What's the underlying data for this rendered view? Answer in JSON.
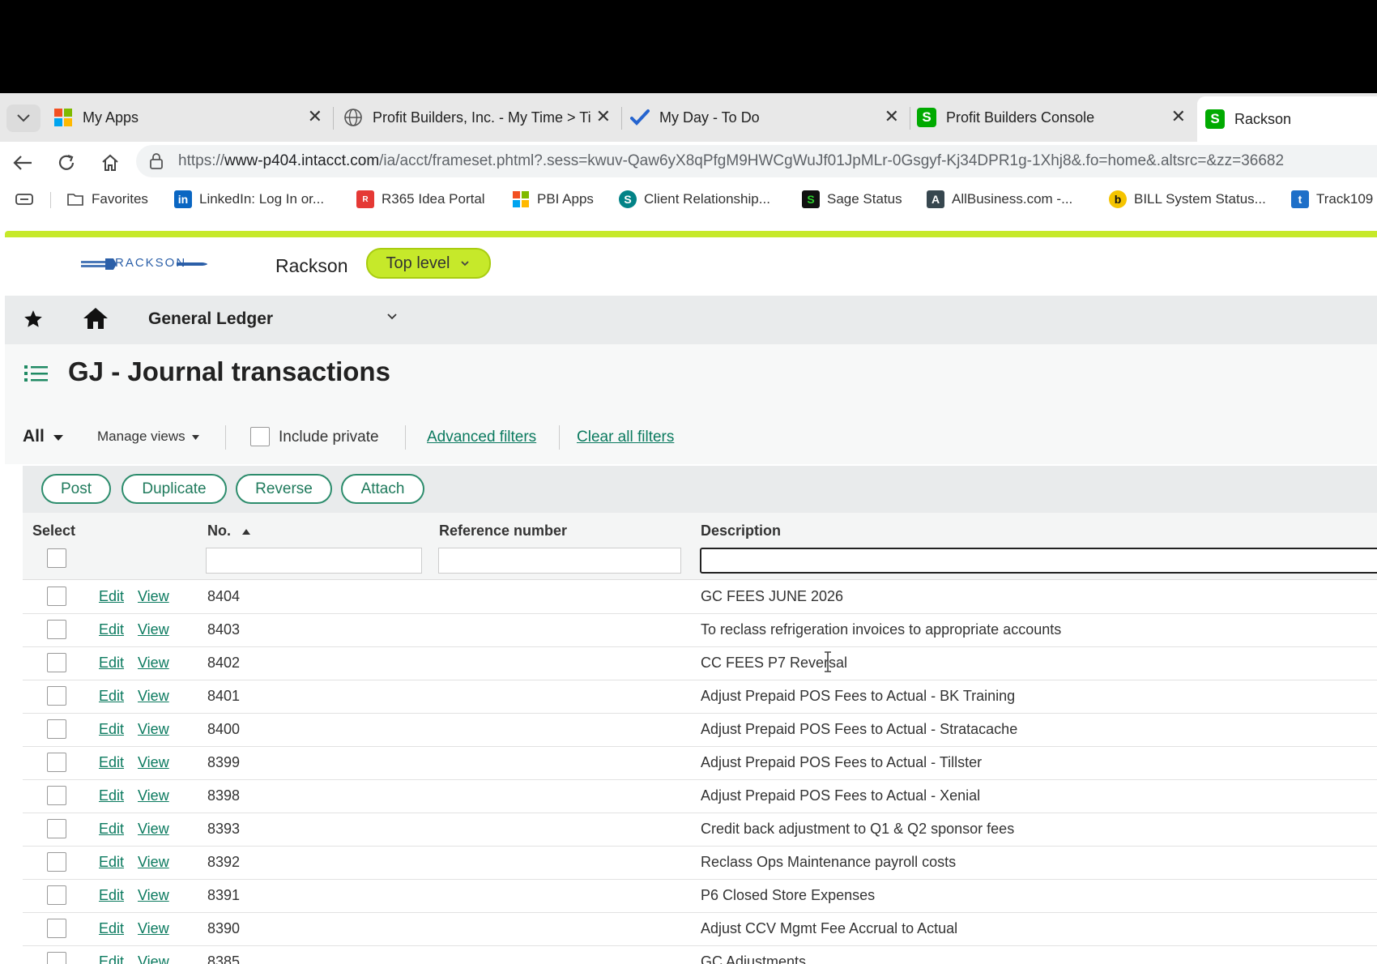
{
  "browser": {
    "tabs": [
      {
        "label": "My Apps",
        "icon": "microsoft-grid-icon",
        "closable": true
      },
      {
        "label": "Profit Builders, Inc. - My Time > Ti",
        "icon": "globe-icon",
        "closable": true
      },
      {
        "label": "My Day - To Do",
        "icon": "checkmark-icon",
        "closable": true
      },
      {
        "label": "Profit Builders Console",
        "icon": "sage-s-icon",
        "closable": true
      },
      {
        "label": "Rackson",
        "icon": "sage-s-icon",
        "closable": false,
        "active": true
      }
    ],
    "url": {
      "scheme": "https://",
      "host": "www-p404.intacct.com",
      "path": "/ia/acct/frameset.phtml?.sess=kwuv-Qaw6yX8qPfgM9HWCgWuJf01JpMLr-0Gsgyf-Kj34DPR1g-1Xhj8&.fo=home&.altsrc=&zz=36682"
    },
    "bookmarks": [
      {
        "label": "Favorites",
        "icon": "folder-icon"
      },
      {
        "label": "LinkedIn: Log In or...",
        "icon": "linkedin-icon"
      },
      {
        "label": "R365 Idea Portal",
        "icon": "r365-icon"
      },
      {
        "label": "PBI Apps",
        "icon": "microsoft-grid-icon"
      },
      {
        "label": "Client Relationship...",
        "icon": "sharepoint-icon"
      },
      {
        "label": "Sage Status",
        "icon": "sage-s-icon"
      },
      {
        "label": "AllBusiness.com -...",
        "icon": "allbusiness-icon"
      },
      {
        "label": "BILL System Status...",
        "icon": "bill-icon"
      },
      {
        "label": "Track109",
        "icon": "track1099-icon"
      }
    ]
  },
  "app": {
    "logo_text": "RACKSON",
    "company": "Rackson",
    "entity_button": "Top level",
    "module": "General Ledger",
    "page_title": "GJ - Journal transactions",
    "filters": {
      "view": "All",
      "manage_views": "Manage views",
      "include_private": "Include private",
      "advanced_filters": "Advanced filters",
      "clear_all_filters": "Clear all filters"
    },
    "actions": [
      "Post",
      "Duplicate",
      "Reverse",
      "Attach"
    ],
    "columns": {
      "select": "Select",
      "no": "No.",
      "reference": "Reference number",
      "description": "Description"
    },
    "row_links": {
      "edit": "Edit",
      "view": "View"
    },
    "rows": [
      {
        "no": "8404",
        "description": "GC FEES JUNE 2026"
      },
      {
        "no": "8403",
        "description": "To reclass refrigeration invoices to appropriate accounts"
      },
      {
        "no": "8402",
        "description": "CC FEES P7 Reversal"
      },
      {
        "no": "8401",
        "description": "Adjust Prepaid POS Fees to Actual - BK Training"
      },
      {
        "no": "8400",
        "description": "Adjust Prepaid POS Fees to Actual - Stratacache"
      },
      {
        "no": "8399",
        "description": "Adjust Prepaid POS Fees to Actual - Tillster"
      },
      {
        "no": "8398",
        "description": "Adjust Prepaid POS Fees to Actual - Xenial"
      },
      {
        "no": "8393",
        "description": "Credit back adjustment to Q1 & Q2 sponsor fees"
      },
      {
        "no": "8392",
        "description": "Reclass Ops Maintenance payroll costs"
      },
      {
        "no": "8391",
        "description": "P6 Closed Store Expenses"
      },
      {
        "no": "8390",
        "description": "Adjust CCV Mgmt Fee Accrual to Actual"
      },
      {
        "no": "8385",
        "description": "GC Adjustments"
      }
    ]
  },
  "colors": {
    "accent_green": "#c6e92a",
    "link_green": "#0b7a5f",
    "button_border": "#2c8c6c"
  }
}
